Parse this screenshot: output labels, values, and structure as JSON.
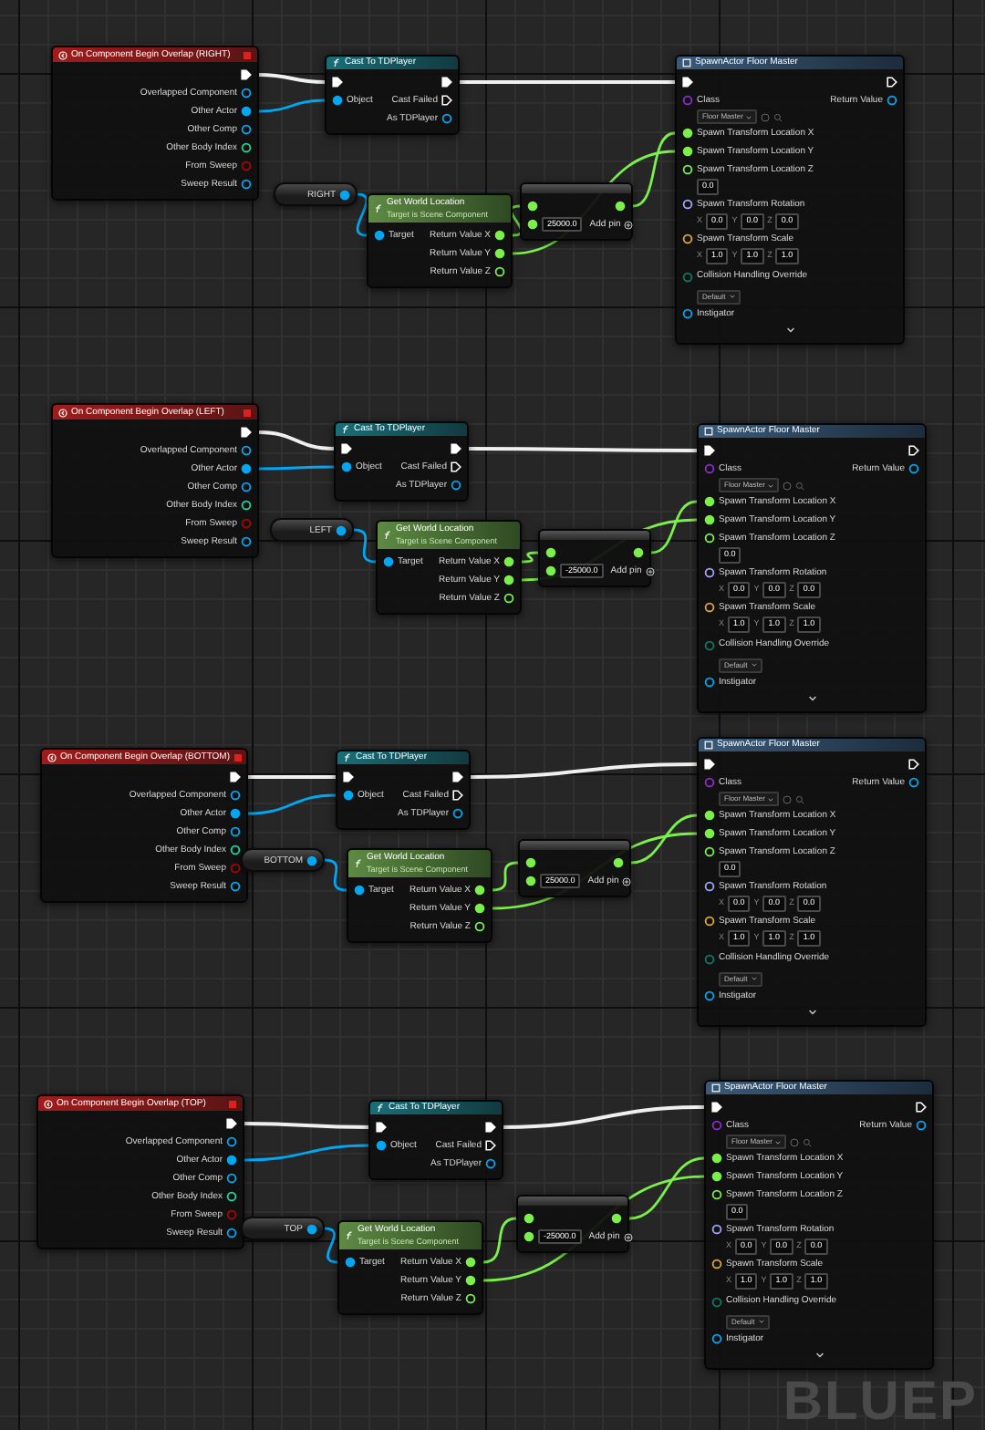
{
  "graphs": [
    {
      "event": {
        "title": "On Component Begin Overlap (RIGHT)",
        "pins": [
          "Overlapped Component",
          "Other Actor",
          "Other Comp",
          "Other Body Index",
          "From Sweep",
          "Sweep Result"
        ]
      },
      "cast": {
        "title": "Cast To TDPlayer",
        "object": "Object",
        "failed": "Cast Failed",
        "result": "As TDPlayer"
      },
      "variable": {
        "label": "RIGHT"
      },
      "get_location": {
        "title": "Get World Location",
        "subtitle": "Target is Scene Component",
        "target": "Target",
        "outputs": [
          "Return Value X",
          "Return Value Y",
          "Return Value Z"
        ]
      },
      "add": {
        "value": "25000.0",
        "add_pin": "Add pin"
      },
      "spawn": {
        "title": "SpawnActor Floor Master",
        "class_label": "Class",
        "class_value": "Floor Master",
        "return_value": "Return Value",
        "location_x": "Spawn Transform Location X",
        "location_y": "Spawn Transform Location Y",
        "location_z": "Spawn Transform Location Z",
        "location_z_value": "0.0",
        "rotation": "Spawn Transform Rotation",
        "rotation_values": [
          {
            "axis": "X",
            "value": "0.0"
          },
          {
            "axis": "Y",
            "value": "0.0"
          },
          {
            "axis": "Z",
            "value": "0.0"
          }
        ],
        "scale": "Spawn Transform Scale",
        "scale_values": [
          {
            "axis": "X",
            "value": "1.0"
          },
          {
            "axis": "Y",
            "value": "1.0"
          },
          {
            "axis": "Z",
            "value": "1.0"
          }
        ],
        "collision": "Collision Handling Override",
        "collision_value": "Default",
        "instigator": "Instigator"
      }
    },
    {
      "event": {
        "title": "On Component Begin Overlap (LEFT)",
        "pins": [
          "Overlapped Component",
          "Other Actor",
          "Other Comp",
          "Other Body Index",
          "From Sweep",
          "Sweep Result"
        ]
      },
      "cast": {
        "title": "Cast To TDPlayer",
        "object": "Object",
        "failed": "Cast Failed",
        "result": "As TDPlayer"
      },
      "variable": {
        "label": "LEFT"
      },
      "get_location": {
        "title": "Get World Location",
        "subtitle": "Target is Scene Component",
        "target": "Target",
        "outputs": [
          "Return Value X",
          "Return Value Y",
          "Return Value Z"
        ]
      },
      "add": {
        "value": "-25000.0",
        "add_pin": "Add pin"
      },
      "spawn": {
        "title": "SpawnActor Floor Master",
        "class_label": "Class",
        "class_value": "Floor Master",
        "return_value": "Return Value",
        "location_x": "Spawn Transform Location X",
        "location_y": "Spawn Transform Location Y",
        "location_z": "Spawn Transform Location Z",
        "location_z_value": "0.0",
        "rotation": "Spawn Transform Rotation",
        "rotation_values": [
          {
            "axis": "X",
            "value": "0.0"
          },
          {
            "axis": "Y",
            "value": "0.0"
          },
          {
            "axis": "Z",
            "value": "0.0"
          }
        ],
        "scale": "Spawn Transform Scale",
        "scale_values": [
          {
            "axis": "X",
            "value": "1.0"
          },
          {
            "axis": "Y",
            "value": "1.0"
          },
          {
            "axis": "Z",
            "value": "1.0"
          }
        ],
        "collision": "Collision Handling Override",
        "collision_value": "Default",
        "instigator": "Instigator"
      }
    },
    {
      "event": {
        "title": "On Component Begin Overlap (BOTTOM)",
        "pins": [
          "Overlapped Component",
          "Other Actor",
          "Other Comp",
          "Other Body Index",
          "From Sweep",
          "Sweep Result"
        ]
      },
      "cast": {
        "title": "Cast To TDPlayer",
        "object": "Object",
        "failed": "Cast Failed",
        "result": "As TDPlayer"
      },
      "variable": {
        "label": "BOTTOM"
      },
      "get_location": {
        "title": "Get World Location",
        "subtitle": "Target is Scene Component",
        "target": "Target",
        "outputs": [
          "Return Value X",
          "Return Value Y",
          "Return Value Z"
        ]
      },
      "add": {
        "value": "25000.0",
        "add_pin": "Add pin"
      },
      "spawn": {
        "title": "SpawnActor Floor Master",
        "class_label": "Class",
        "class_value": "Floor Master",
        "return_value": "Return Value",
        "location_x": "Spawn Transform Location X",
        "location_y": "Spawn Transform Location Y",
        "location_z": "Spawn Transform Location Z",
        "location_z_value": "0.0",
        "rotation": "Spawn Transform Rotation",
        "rotation_values": [
          {
            "axis": "X",
            "value": "0.0"
          },
          {
            "axis": "Y",
            "value": "0.0"
          },
          {
            "axis": "Z",
            "value": "0.0"
          }
        ],
        "scale": "Spawn Transform Scale",
        "scale_values": [
          {
            "axis": "X",
            "value": "1.0"
          },
          {
            "axis": "Y",
            "value": "1.0"
          },
          {
            "axis": "Z",
            "value": "1.0"
          }
        ],
        "collision": "Collision Handling Override",
        "collision_value": "Default",
        "instigator": "Instigator"
      }
    },
    {
      "event": {
        "title": "On Component Begin Overlap (TOP)",
        "pins": [
          "Overlapped Component",
          "Other Actor",
          "Other Comp",
          "Other Body Index",
          "From Sweep",
          "Sweep Result"
        ]
      },
      "cast": {
        "title": "Cast To TDPlayer",
        "object": "Object",
        "failed": "Cast Failed",
        "result": "As TDPlayer"
      },
      "variable": {
        "label": "TOP"
      },
      "get_location": {
        "title": "Get World Location",
        "subtitle": "Target is Scene Component",
        "target": "Target",
        "outputs": [
          "Return Value X",
          "Return Value Y",
          "Return Value Z"
        ]
      },
      "add": {
        "value": "-25000.0",
        "add_pin": "Add pin"
      },
      "spawn": {
        "title": "SpawnActor Floor Master",
        "class_label": "Class",
        "class_value": "Floor Master",
        "return_value": "Return Value",
        "location_x": "Spawn Transform Location X",
        "location_y": "Spawn Transform Location Y",
        "location_z": "Spawn Transform Location Z",
        "location_z_value": "0.0",
        "rotation": "Spawn Transform Rotation",
        "rotation_values": [
          {
            "axis": "X",
            "value": "0.0"
          },
          {
            "axis": "Y",
            "value": "0.0"
          },
          {
            "axis": "Z",
            "value": "0.0"
          }
        ],
        "scale": "Spawn Transform Scale",
        "scale_values": [
          {
            "axis": "X",
            "value": "1.0"
          },
          {
            "axis": "Y",
            "value": "1.0"
          },
          {
            "axis": "Z",
            "value": "1.0"
          }
        ],
        "collision": "Collision Handling Override",
        "collision_value": "Default",
        "instigator": "Instigator"
      }
    }
  ],
  "corner_label": "BLUEP"
}
